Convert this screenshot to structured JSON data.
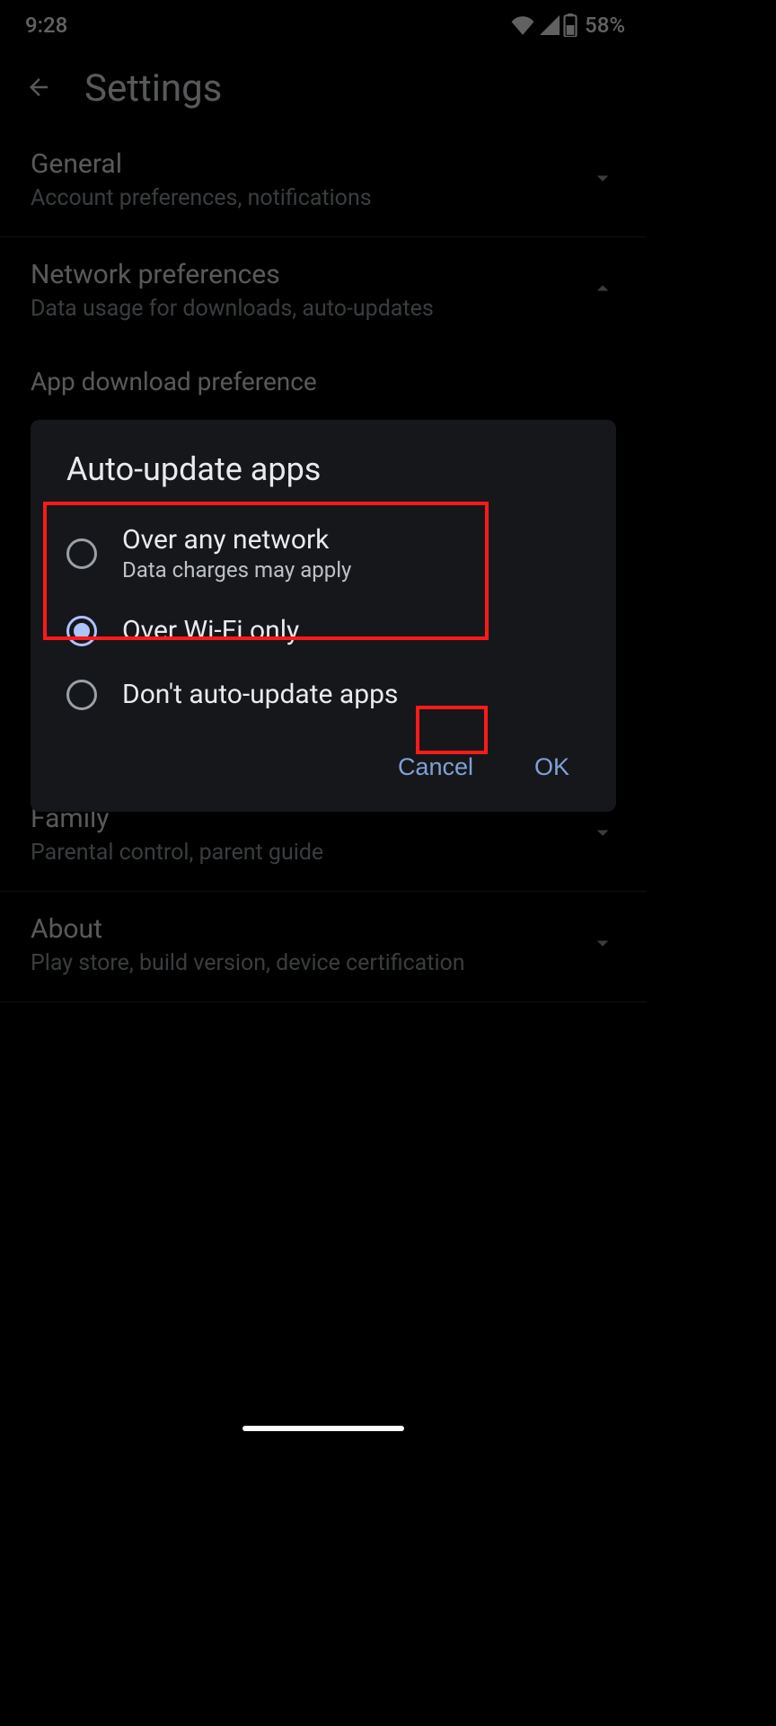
{
  "status": {
    "time": "9:28",
    "battery": "58%"
  },
  "header": {
    "title": "Settings"
  },
  "sections": {
    "general": {
      "title": "General",
      "sub": "Account preferences, notifications"
    },
    "network": {
      "title": "Network preferences",
      "sub": "Data usage for downloads, auto-updates"
    },
    "download": {
      "title": "App download preference"
    },
    "family": {
      "title": "Family",
      "sub": "Parental control, parent guide"
    },
    "about": {
      "title": "About",
      "sub": "Play store, build version, device certification"
    }
  },
  "dialog": {
    "title": "Auto-update apps",
    "options": [
      {
        "label": "Over any network",
        "sub": "Data charges may apply",
        "selected": false
      },
      {
        "label": "Over Wi-Fi only",
        "sub": "",
        "selected": true
      },
      {
        "label": "Don't auto-update apps",
        "sub": "",
        "selected": false
      }
    ],
    "cancel": "Cancel",
    "ok": "OK"
  }
}
